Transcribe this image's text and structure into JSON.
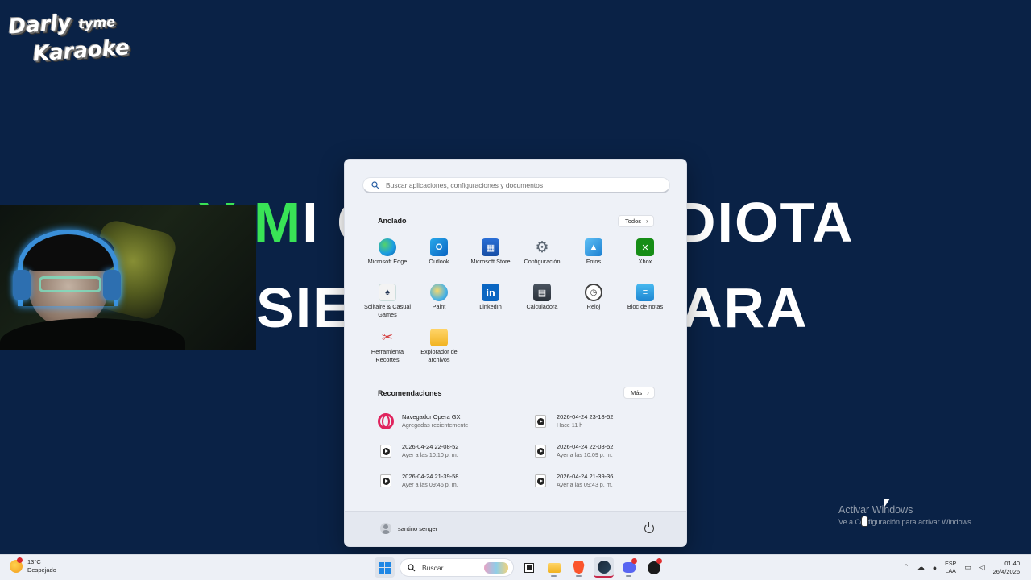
{
  "background": {
    "logo": {
      "line1_big": "Darly",
      "line1_small": "tyme",
      "line2": "Karaoke"
    },
    "lyrics": {
      "line1_highlight": "Y M",
      "line1_left_rest": "I C",
      "line1_right": "DIOTA",
      "line2_left": "SIEM",
      "line2_right": "ARA"
    },
    "highlight_color": "#39e356",
    "bg_color": "#0a2246"
  },
  "start_menu": {
    "search": {
      "placeholder": "Buscar aplicaciones, configuraciones y documentos"
    },
    "pinned": {
      "title": "Anclado",
      "all_button": "Todos",
      "apps": [
        {
          "label": "Microsoft Edge",
          "icon": "edge-icon"
        },
        {
          "label": "Outlook",
          "icon": "outlook-icon"
        },
        {
          "label": "Microsoft Store",
          "icon": "store-icon"
        },
        {
          "label": "Configuración",
          "icon": "gear-icon"
        },
        {
          "label": "Fotos",
          "icon": "photos-icon"
        },
        {
          "label": "Xbox",
          "icon": "xbox-icon"
        },
        {
          "label": "Solitaire & Casual Games",
          "icon": "solitaire-icon"
        },
        {
          "label": "Paint",
          "icon": "paint-icon"
        },
        {
          "label": "LinkedIn",
          "icon": "linkedin-icon"
        },
        {
          "label": "Calculadora",
          "icon": "calculator-icon"
        },
        {
          "label": "Reloj",
          "icon": "clock-icon"
        },
        {
          "label": "Bloc de notas",
          "icon": "notepad-icon"
        },
        {
          "label": "Herramienta Recortes",
          "icon": "snipping-tool-icon"
        },
        {
          "label": "Explorador de archivos",
          "icon": "folder-icon"
        }
      ]
    },
    "recommended": {
      "title": "Recomendaciones",
      "more_button": "Más",
      "items": [
        {
          "title": "Navegador Opera GX",
          "subtitle": "Agregadas recientemente",
          "icon": "opera-gx-icon"
        },
        {
          "title": "2026-04-24 23-18-52",
          "subtitle": "Hace 11 h",
          "icon": "video-file-icon"
        },
        {
          "title": "2026-04-24 22-08-52",
          "subtitle": "Ayer a las 10:10 p. m.",
          "icon": "video-file-icon"
        },
        {
          "title": "2026-04-24 22-08-52",
          "subtitle": "Ayer a las 10:09 p. m.",
          "icon": "video-file-icon"
        },
        {
          "title": "2026-04-24 21-39-58",
          "subtitle": "Ayer a las 09:46 p. m.",
          "icon": "video-file-icon"
        },
        {
          "title": "2026-04-24 21-39-36",
          "subtitle": "Ayer a las 09:43 p. m.",
          "icon": "video-file-icon"
        }
      ]
    },
    "footer": {
      "user_name": "santino senger",
      "power_icon": "power-icon"
    }
  },
  "watermark": {
    "title": "Activar Windows",
    "subtitle": "Ve a Configuración para activar Windows."
  },
  "taskbar": {
    "weather": {
      "temp": "13°C",
      "desc": "Despejado"
    },
    "search_label": "Buscar",
    "language": {
      "line1": "ESP",
      "line2": "LAA"
    },
    "clock": {
      "time": "01:40",
      "date": "26/4/2026"
    }
  }
}
